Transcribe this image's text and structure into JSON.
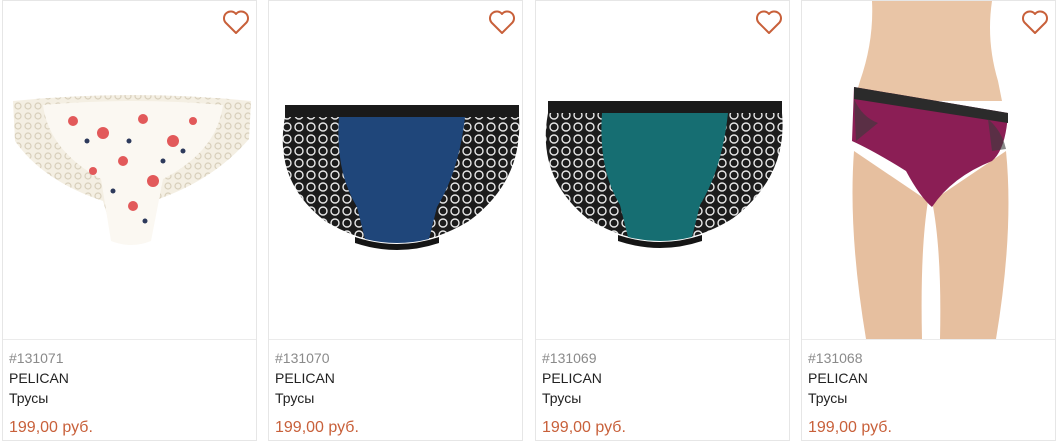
{
  "accent_color": "#c8603a",
  "favorite_icon": "heart-outline-icon",
  "products": [
    {
      "sku": "#131071",
      "brand": "PELICAN",
      "name": "Трусы",
      "price": "199,00 руб.",
      "image": "floral-briefs-with-cream-lace"
    },
    {
      "sku": "#131070",
      "brand": "PELICAN",
      "name": "Трусы",
      "price": "199,00 руб.",
      "image": "navy-briefs-with-black-lace"
    },
    {
      "sku": "#131069",
      "brand": "PELICAN",
      "name": "Трусы",
      "price": "199,00 руб.",
      "image": "teal-briefs-with-black-lace"
    },
    {
      "sku": "#131068",
      "brand": "PELICAN",
      "name": "Трусы",
      "price": "199,00 руб.",
      "image": "model-wearing-burgundy-briefs"
    }
  ]
}
